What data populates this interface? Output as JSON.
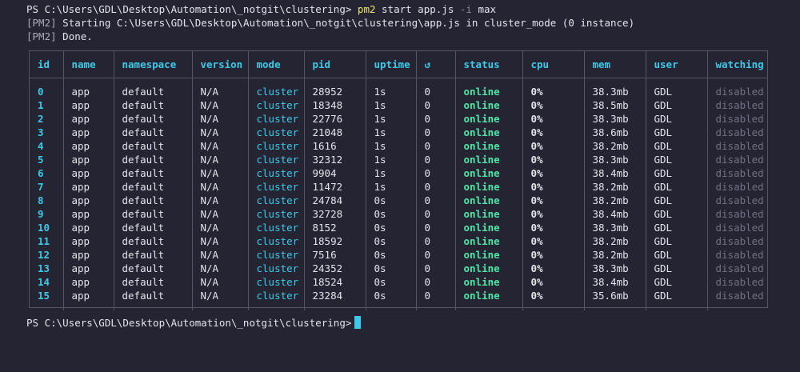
{
  "command": {
    "prompt": "PS C:\\Users\\GDL\\Desktop\\Automation\\_notgit\\clustering>",
    "program": "pm2",
    "args": "start app.js",
    "flag": "-i",
    "flag_value": "max"
  },
  "output": [
    {
      "tag": "[PM2]",
      "text": "Starting C:\\Users\\GDL\\Desktop\\Automation\\_notgit\\clustering\\app.js in cluster_mode (0 instance)"
    },
    {
      "tag": "[PM2]",
      "text": "Done."
    }
  ],
  "table": {
    "headers": [
      "id",
      "name",
      "namespace",
      "version",
      "mode",
      "pid",
      "uptime",
      "↺",
      "status",
      "cpu",
      "mem",
      "user",
      "watching"
    ],
    "rows": [
      [
        "0",
        "app",
        "default",
        "N/A",
        "cluster",
        "28952",
        "1s",
        "0",
        "online",
        "0%",
        "38.3mb",
        "GDL",
        "disabled"
      ],
      [
        "1",
        "app",
        "default",
        "N/A",
        "cluster",
        "18348",
        "1s",
        "0",
        "online",
        "0%",
        "38.5mb",
        "GDL",
        "disabled"
      ],
      [
        "2",
        "app",
        "default",
        "N/A",
        "cluster",
        "22776",
        "1s",
        "0",
        "online",
        "0%",
        "38.3mb",
        "GDL",
        "disabled"
      ],
      [
        "3",
        "app",
        "default",
        "N/A",
        "cluster",
        "21048",
        "1s",
        "0",
        "online",
        "0%",
        "38.6mb",
        "GDL",
        "disabled"
      ],
      [
        "4",
        "app",
        "default",
        "N/A",
        "cluster",
        "1616",
        "1s",
        "0",
        "online",
        "0%",
        "38.2mb",
        "GDL",
        "disabled"
      ],
      [
        "5",
        "app",
        "default",
        "N/A",
        "cluster",
        "32312",
        "1s",
        "0",
        "online",
        "0%",
        "38.3mb",
        "GDL",
        "disabled"
      ],
      [
        "6",
        "app",
        "default",
        "N/A",
        "cluster",
        "9904",
        "1s",
        "0",
        "online",
        "0%",
        "38.4mb",
        "GDL",
        "disabled"
      ],
      [
        "7",
        "app",
        "default",
        "N/A",
        "cluster",
        "11472",
        "1s",
        "0",
        "online",
        "0%",
        "38.2mb",
        "GDL",
        "disabled"
      ],
      [
        "8",
        "app",
        "default",
        "N/A",
        "cluster",
        "24784",
        "0s",
        "0",
        "online",
        "0%",
        "38.2mb",
        "GDL",
        "disabled"
      ],
      [
        "9",
        "app",
        "default",
        "N/A",
        "cluster",
        "32728",
        "0s",
        "0",
        "online",
        "0%",
        "38.4mb",
        "GDL",
        "disabled"
      ],
      [
        "10",
        "app",
        "default",
        "N/A",
        "cluster",
        "8152",
        "0s",
        "0",
        "online",
        "0%",
        "38.3mb",
        "GDL",
        "disabled"
      ],
      [
        "11",
        "app",
        "default",
        "N/A",
        "cluster",
        "18592",
        "0s",
        "0",
        "online",
        "0%",
        "38.2mb",
        "GDL",
        "disabled"
      ],
      [
        "12",
        "app",
        "default",
        "N/A",
        "cluster",
        "7516",
        "0s",
        "0",
        "online",
        "0%",
        "38.2mb",
        "GDL",
        "disabled"
      ],
      [
        "13",
        "app",
        "default",
        "N/A",
        "cluster",
        "24352",
        "0s",
        "0",
        "online",
        "0%",
        "38.3mb",
        "GDL",
        "disabled"
      ],
      [
        "14",
        "app",
        "default",
        "N/A",
        "cluster",
        "18524",
        "0s",
        "0",
        "online",
        "0%",
        "38.4mb",
        "GDL",
        "disabled"
      ],
      [
        "15",
        "app",
        "default",
        "N/A",
        "cluster",
        "23284",
        "0s",
        "0",
        "online",
        "0%",
        "35.6mb",
        "GDL",
        "disabled"
      ]
    ]
  },
  "final_prompt": "PS C:\\Users\\GDL\\Desktop\\Automation\\_notgit\\clustering>",
  "colors": {
    "background": "#242433",
    "accent_cyan": "#3fc9e8",
    "status_green": "#4fe6a6",
    "command_yellow": "#f0e26e"
  }
}
